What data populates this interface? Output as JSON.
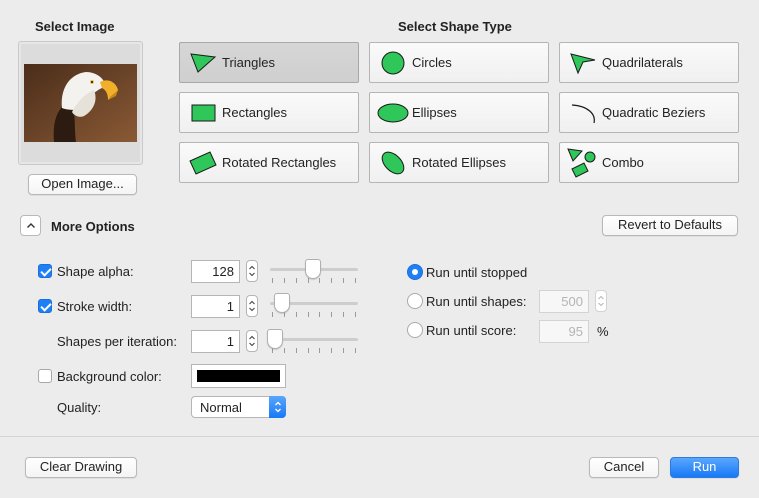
{
  "image_section": {
    "heading": "Select Image",
    "open_button": "Open Image..."
  },
  "shape_section": {
    "heading": "Select Shape Type",
    "selected": "triangles",
    "shapes": [
      {
        "id": "triangles",
        "label": "Triangles",
        "icon": "triangle-icon"
      },
      {
        "id": "circles",
        "label": "Circles",
        "icon": "circle-icon"
      },
      {
        "id": "quadrilaterals",
        "label": "Quadrilaterals",
        "icon": "quadrilateral-icon"
      },
      {
        "id": "rectangles",
        "label": "Rectangles",
        "icon": "rectangle-icon"
      },
      {
        "id": "ellipses",
        "label": "Ellipses",
        "icon": "ellipse-icon"
      },
      {
        "id": "quadratic-beziers",
        "label": "Quadratic Beziers",
        "icon": "bezier-curve-icon"
      },
      {
        "id": "rotated-rectangles",
        "label": "Rotated Rectangles",
        "icon": "rotated-rectangle-icon"
      },
      {
        "id": "rotated-ellipses",
        "label": "Rotated Ellipses",
        "icon": "rotated-ellipse-icon"
      },
      {
        "id": "combo",
        "label": "Combo",
        "icon": "combo-shapes-icon"
      }
    ],
    "icon_fill": "#2fc65a",
    "icon_stroke": "#1a1a1a"
  },
  "options": {
    "toggle_label": "More Options",
    "revert_button": "Revert to Defaults",
    "shape_alpha": {
      "label": "Shape alpha:",
      "checked": true,
      "value": "128",
      "slider_fraction": 0.5
    },
    "stroke_width": {
      "label": "Stroke width:",
      "checked": true,
      "value": "1",
      "slider_fraction": 0.1
    },
    "shapes_per_iteration": {
      "label": "Shapes per iteration:",
      "value": "1",
      "slider_fraction": 0.0
    },
    "background_color": {
      "label": "Background color:",
      "checked": false,
      "color": "#000000"
    },
    "quality": {
      "label": "Quality:",
      "value": "Normal"
    },
    "run_mode": {
      "selected": "until_stopped",
      "until_stopped": "Run until stopped",
      "until_shapes": "Run until shapes:",
      "until_shapes_value": "500",
      "until_score": "Run until score:",
      "until_score_value": "95",
      "score_unit": "%"
    }
  },
  "footer": {
    "clear_button": "Clear Drawing",
    "cancel_button": "Cancel",
    "run_button": "Run"
  },
  "colors": {
    "accent": "#1f80f5",
    "window_bg": "#ececec"
  }
}
